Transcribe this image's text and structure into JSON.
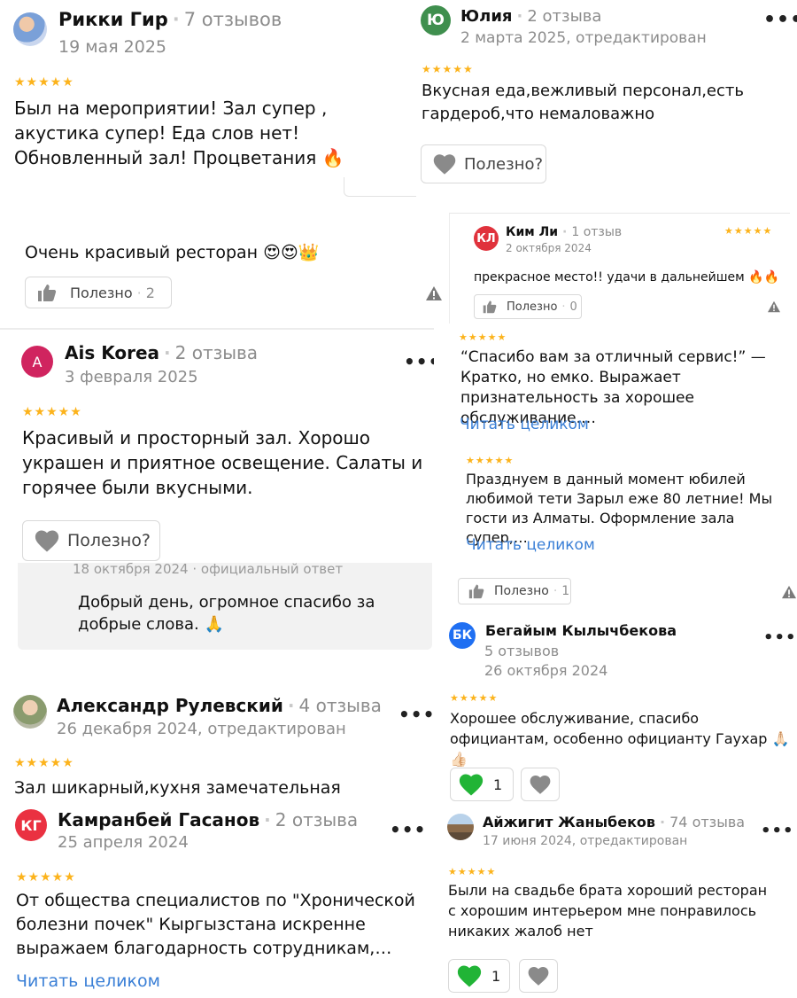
{
  "reviews": {
    "rikki": {
      "name": "Рикки Гир",
      "count": "7 отзывов",
      "date": "19 мая 2025",
      "stars": "★★★★★",
      "text": "Был на мероприятии! Зал супер , акустика супер! Еда слов нет! Обновленный зал! Процветания 🔥"
    },
    "yulia": {
      "initials": "Ю",
      "name": "Юлия",
      "count": "2 отзыва",
      "date": "2 марта 2025, отредактирован",
      "stars": "★★★★★",
      "text": "Вкусная еда,вежливый персонал,есть гардероб,что немаловажно",
      "helpful": "Полезно?"
    },
    "beautiful": {
      "text": "Очень красивый ресторан 😍😍👑",
      "helpful": "Полезно",
      "helpful_count": "2"
    },
    "kimli": {
      "initials": "КЛ",
      "name": "Ким Ли",
      "count": "1 отзыв",
      "date": "2 октября 2024",
      "stars": "★★★★★",
      "text": "прекрасное место!! удачи в дальнейшем 🔥🔥",
      "helpful": "Полезно",
      "helpful_count": "0"
    },
    "ais": {
      "initials": "A",
      "name": "Ais Korea",
      "count": "2 отзыва",
      "date": "3 февраля 2025",
      "stars": "★★★★★",
      "text": "Красивый и просторный зал. Хорошо украшен и приятное освещение. Салаты и горячее были вкусными.",
      "helpful": "Полезно?",
      "reply_meta": "18 октября 2024 · официальный ответ",
      "reply_text": "Добрый день, огромное спасибо за добрые слова. 🙏"
    },
    "thanks": {
      "stars": "★★★★★",
      "text": "“Спасибо вам за отличный сервис!” — Кратко, но емко. Выражает признательность за хорошее обслуживание.…",
      "read_more": "Читать целиком"
    },
    "jubilee": {
      "stars": "★★★★★",
      "text": "Празднуем в данный момент юбилей любимой тети Зарыл еже 80 летние! Мы гости из Алматы. Оформление зала супер,…",
      "read_more": "Читать целиком",
      "helpful": "Полезно",
      "helpful_count": "1"
    },
    "begaiym": {
      "initials": "БК",
      "name": "Бегайым Кылычбекова",
      "count": "5 отзывов",
      "date": "26 октября 2024",
      "stars": "★★★★★",
      "text": "Хорошее обслуживание, спасибо официантам, особенно официанту Гаухар 🙏🏻 👍🏻",
      "likes": "1"
    },
    "alexander": {
      "name": "Александр Рулевский",
      "count": "4 отзыва",
      "date": "26 декабря 2024, отредактирован",
      "stars": "★★★★★",
      "text": "Зал шикарный,кухня замечательная"
    },
    "kamranbey": {
      "initials": "КГ",
      "name": "Камранбей Гасанов",
      "count": "2 отзыва",
      "date": "25 апреля 2024",
      "stars": "★★★★★",
      "text": "От общества специалистов по \"Хронической болезни почек\" Кыргызстана искренне выражаем благодарность сотрудникам,…",
      "read_more": "Читать целиком"
    },
    "aijigit": {
      "name": "Айжигит Жаныбеков",
      "count": "74 отзыва",
      "date": "17 июня 2024, отредактирован",
      "stars": "★★★★★",
      "text": "Были на свадьбе брата хороший ресторан с хорошим интерьером мне понравилось никаких жалоб нет",
      "likes": "1"
    }
  },
  "colors": {
    "star": "#fcb31c",
    "link": "#3a7fd6",
    "muted": "#8c8c8c",
    "avatar_yulia": "#3f8f4e",
    "avatar_kimli": "#e0323c",
    "avatar_ais": "#d0245f",
    "avatar_begaiym": "#1f6ff2",
    "avatar_kamranbey": "#ea3141",
    "heart_green": "#21b436",
    "heart_grey": "#8a8a8a"
  },
  "icons": [
    "thumb-up-icon",
    "heart-icon",
    "green-heart-icon",
    "warning-icon",
    "more-dots-icon",
    "avatar-photo"
  ]
}
